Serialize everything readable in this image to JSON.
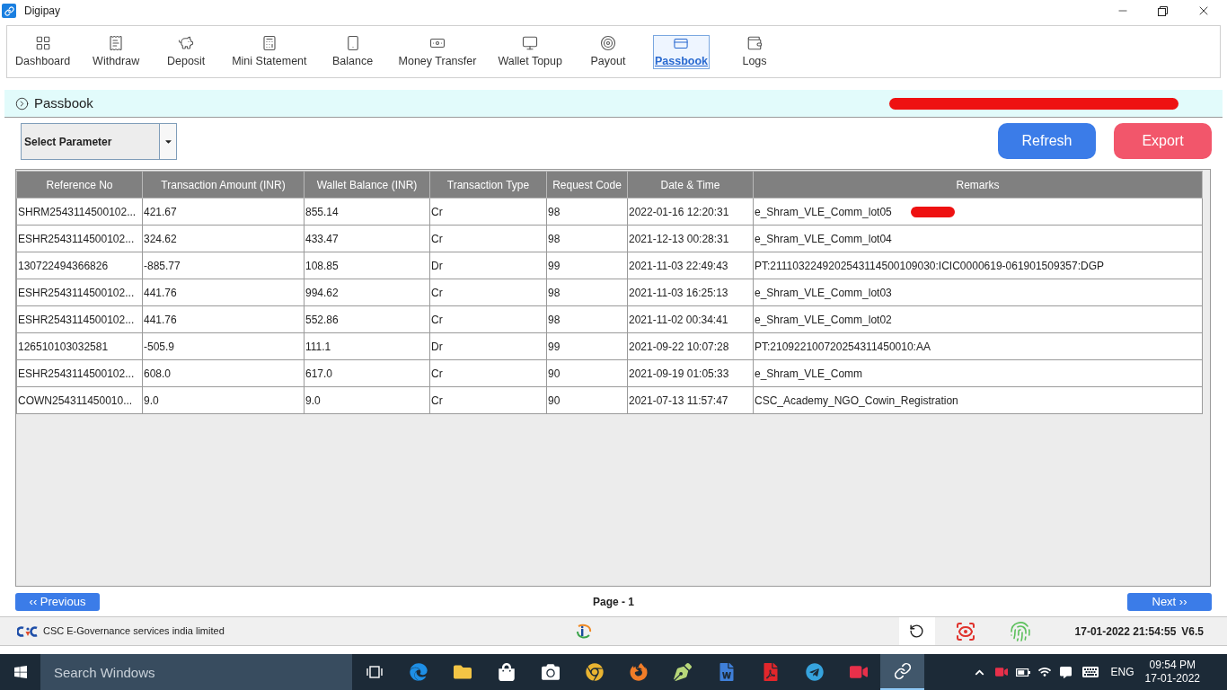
{
  "window": {
    "title": "Digipay"
  },
  "toolbar": [
    {
      "label": "Dashboard",
      "selected": false
    },
    {
      "label": "Withdraw",
      "selected": false
    },
    {
      "label": "Deposit",
      "selected": false
    },
    {
      "label": "Mini Statement",
      "selected": false
    },
    {
      "label": "Balance",
      "selected": false
    },
    {
      "label": "Money Transfer",
      "selected": false
    },
    {
      "label": "Wallet Topup",
      "selected": false
    },
    {
      "label": "Payout",
      "selected": false
    },
    {
      "label": "Passbook",
      "selected": true
    },
    {
      "label": "Logs",
      "selected": false
    }
  ],
  "page_header": {
    "title": "Passbook",
    "redacted": true
  },
  "filter": {
    "value": "Select Parameter"
  },
  "actions": [
    {
      "label": "Refresh",
      "kind": "primary"
    },
    {
      "label": "Export",
      "kind": "danger"
    }
  ],
  "table": {
    "columns": [
      "Reference No",
      "Transaction Amount (INR)",
      "Wallet Balance (INR)",
      "Transaction Type",
      "Request Code",
      "Date & Time",
      "Remarks"
    ],
    "rows": [
      {
        "cells": [
          "SHRM2543114500102...",
          "421.67",
          "855.14",
          "Cr",
          "98",
          "2022-01-16 12:20:31",
          "e_Shram_VLE_Comm_lot05"
        ],
        "redacted": true
      },
      {
        "cells": [
          "ESHR2543114500102...",
          "324.62",
          "433.47",
          "Cr",
          "98",
          "2021-12-13 00:28:31",
          "e_Shram_VLE_Comm_lot04"
        ],
        "redacted": false
      },
      {
        "cells": [
          "130722494366826",
          "-885.77",
          "108.85",
          "Dr",
          "99",
          "2021-11-03 22:49:43",
          "PT:2111032249202543114500109030:ICIC0000619-061901509357:DGP"
        ],
        "redacted": false
      },
      {
        "cells": [
          "ESHR2543114500102...",
          "441.76",
          "994.62",
          "Cr",
          "98",
          "2021-11-03 16:25:13",
          "e_Shram_VLE_Comm_lot03"
        ],
        "redacted": false
      },
      {
        "cells": [
          "ESHR2543114500102...",
          "441.76",
          "552.86",
          "Cr",
          "98",
          "2021-11-02 00:34:41",
          "e_Shram_VLE_Comm_lot02"
        ],
        "redacted": false
      },
      {
        "cells": [
          "126510103032581",
          "-505.9",
          "111.1",
          "Dr",
          "99",
          "2021-09-22 10:07:28",
          "PT:210922100720254311450010:AA"
        ],
        "redacted": false
      },
      {
        "cells": [
          "ESHR2543114500102...",
          "608.0",
          "617.0",
          "Cr",
          "90",
          "2021-09-19 01:05:33",
          "e_Shram_VLE_Comm"
        ],
        "redacted": false
      },
      {
        "cells": [
          "COWN254311450010...",
          "9.0",
          "9.0",
          "Cr",
          "90",
          "2021-07-13 11:57:47",
          "CSC_Academy_NGO_Cowin_Registration"
        ],
        "redacted": false
      }
    ]
  },
  "pagination": {
    "previous": "‹‹ Previous",
    "page": "Page - 1",
    "next": "Next ››"
  },
  "status_bar": {
    "company": "CSC E-Governance services india limited",
    "datetime": "17-01-2022 21:54:55",
    "version": "V6.5"
  },
  "taskbar": {
    "search": {
      "placeholder": "Search Windows"
    },
    "apps": [
      {
        "selected": false
      },
      {
        "selected": false
      },
      {
        "selected": false
      },
      {
        "selected": false
      },
      {
        "selected": false
      },
      {
        "selected": false
      },
      {
        "selected": false
      },
      {
        "selected": false
      },
      {
        "selected": false
      },
      {
        "selected": false
      },
      {
        "selected": false
      },
      {
        "selected": true
      }
    ],
    "language": "ENG",
    "time": "09:54 PM",
    "date": "17-01-2022"
  }
}
